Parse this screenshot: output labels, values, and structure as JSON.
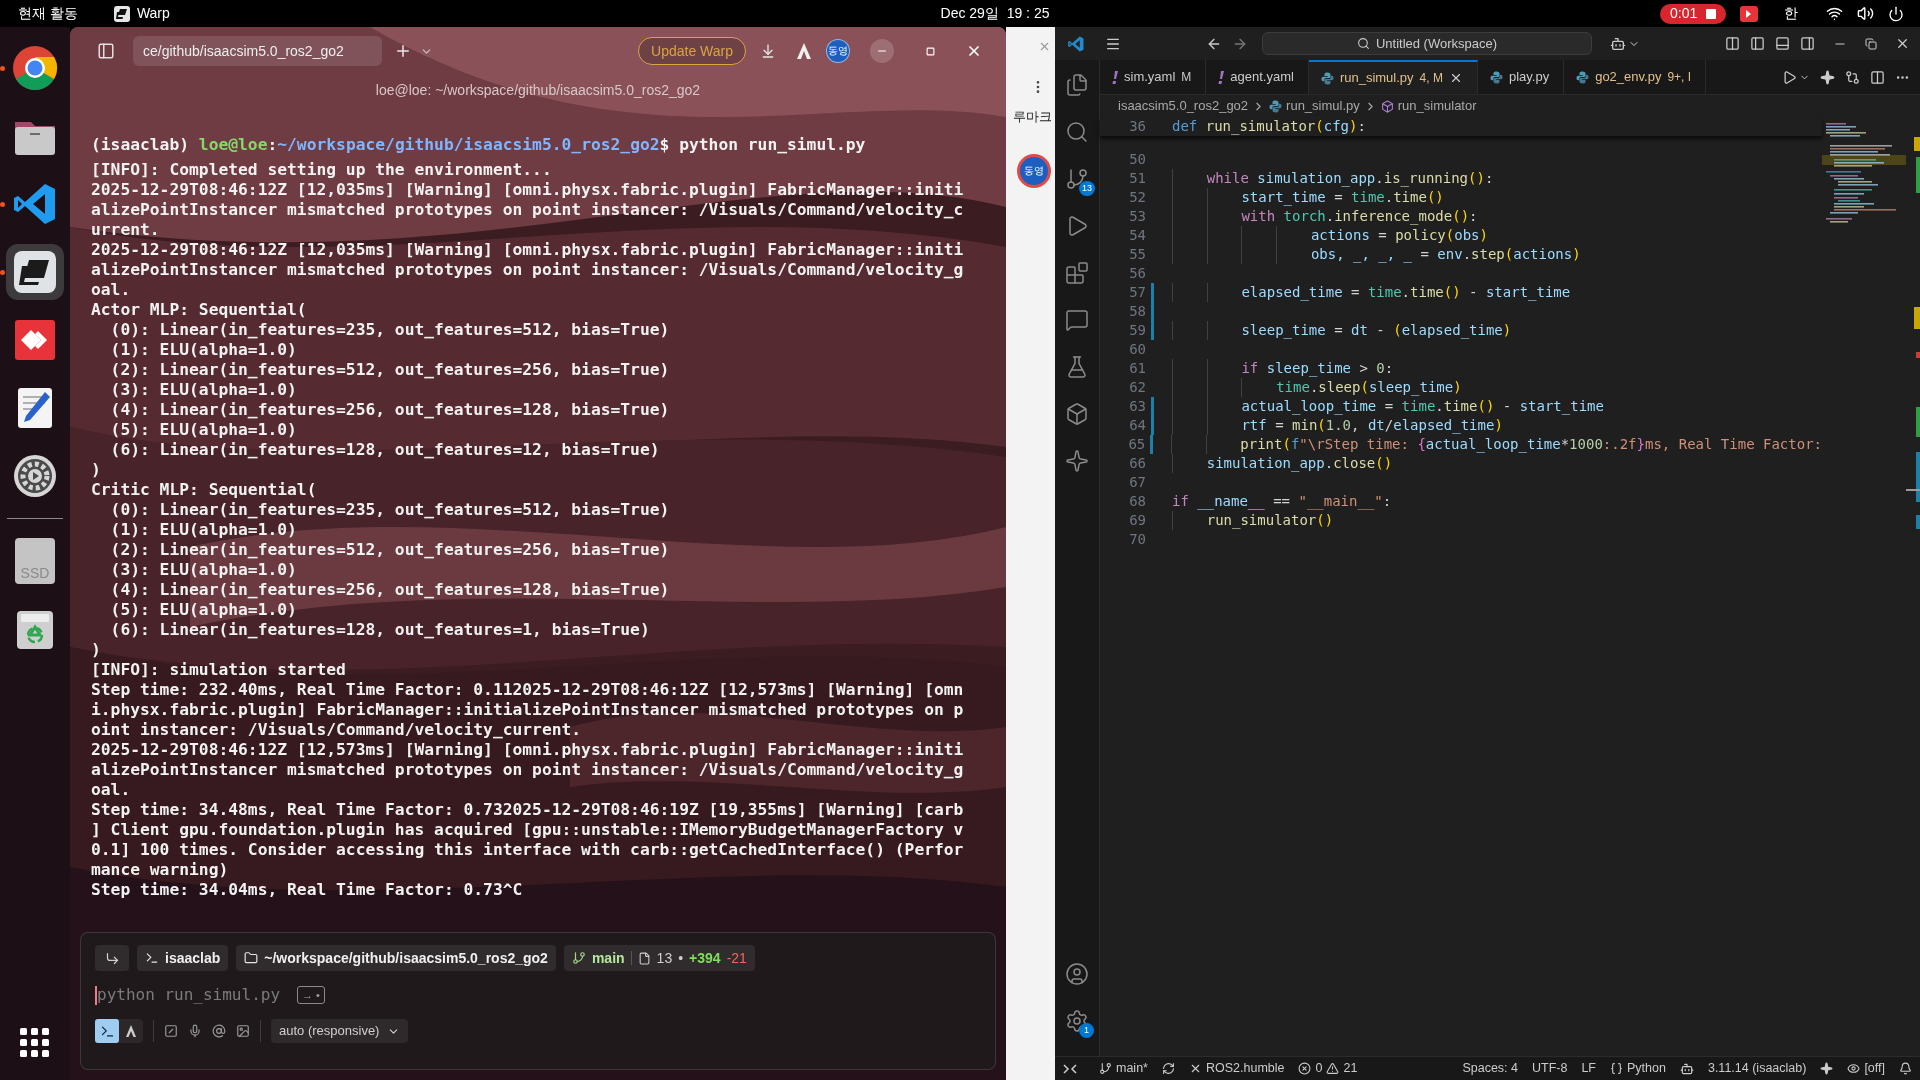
{
  "top_bar": {
    "activities": "현재 활동",
    "app_name": "Warp",
    "clock": "Dec 29일  19 : 25",
    "recording_time": "0:01",
    "input_method": "한"
  },
  "dock": {
    "items": [
      {
        "kind": "browser",
        "running": true,
        "selected": false
      },
      {
        "kind": "files",
        "running": false,
        "selected": false
      },
      {
        "kind": "code",
        "running": true,
        "selected": false
      },
      {
        "kind": "terminal",
        "running": true,
        "selected": true
      },
      {
        "kind": "remote",
        "running": false,
        "selected": false
      },
      {
        "kind": "editor",
        "running": false,
        "selected": false
      },
      {
        "kind": "settings",
        "running": false,
        "selected": false
      },
      {
        "kind": "drive",
        "running": false,
        "selected": false,
        "label": "SSD"
      },
      {
        "kind": "trash",
        "running": false,
        "selected": false
      }
    ]
  },
  "warp": {
    "tab_path": "ce/github/isaacsim5.0_ros2_go2",
    "update_button": "Update Warp",
    "avatar_badge": "동영",
    "title": "loe@loe: ~/workspace/github/isaacsim5.0_ros2_go2",
    "prompt": {
      "env": "(isaaclab) ",
      "host": "loe@loe",
      "sep": ":",
      "path": "~/workspace/github/isaacsim5.0_ros2_go2",
      "command": "$ python run_simul.py"
    },
    "output": [
      "[INFO]: Completed setting up the environment...",
      "2025-12-29T08:46:12Z [12,035ms] [Warning] [omni.physx.fabric.plugin] FabricManager::initi",
      "alizePointInstancer mismatched prototypes on point instancer: /Visuals/Command/velocity_c",
      "urrent.",
      "2025-12-29T08:46:12Z [12,035ms] [Warning] [omni.physx.fabric.plugin] FabricManager::initi",
      "alizePointInstancer mismatched prototypes on point instancer: /Visuals/Command/velocity_g",
      "oal.",
      "Actor MLP: Sequential(",
      "  (0): Linear(in_features=235, out_features=512, bias=True)",
      "  (1): ELU(alpha=1.0)",
      "  (2): Linear(in_features=512, out_features=256, bias=True)",
      "  (3): ELU(alpha=1.0)",
      "  (4): Linear(in_features=256, out_features=128, bias=True)",
      "  (5): ELU(alpha=1.0)",
      "  (6): Linear(in_features=128, out_features=12, bias=True)",
      ")",
      "Critic MLP: Sequential(",
      "  (0): Linear(in_features=235, out_features=512, bias=True)",
      "  (1): ELU(alpha=1.0)",
      "  (2): Linear(in_features=512, out_features=256, bias=True)",
      "  (3): ELU(alpha=1.0)",
      "  (4): Linear(in_features=256, out_features=128, bias=True)",
      "  (5): ELU(alpha=1.0)",
      "  (6): Linear(in_features=128, out_features=1, bias=True)",
      ")",
      "[INFO]: simulation started",
      "Step time: 232.40ms, Real Time Factor: 0.112025-12-29T08:46:12Z [12,573ms] [Warning] [omn",
      "i.physx.fabric.plugin] FabricManager::initializePointInstancer mismatched prototypes on p",
      "oint instancer: /Visuals/Command/velocity_current.",
      "2025-12-29T08:46:12Z [12,573ms] [Warning] [omni.physx.fabric.plugin] FabricManager::initi",
      "alizePointInstancer mismatched prototypes on point instancer: /Visuals/Command/velocity_g",
      "oal.",
      "Step time: 34.48ms, Real Time Factor: 0.732025-12-29T08:46:19Z [19,355ms] [Warning] [carb",
      "] Client gpu.foundation.plugin has acquired [gpu::unstable::IMemoryBudgetManagerFactory v",
      "0.1] 100 times. Consider accessing this interface with carb::getCachedInterface() (Perfor",
      "mance warning)",
      "Step time: 34.04ms, Real Time Factor: 0.73^C"
    ],
    "input": {
      "env": "isaaclab",
      "path": "~/workspace/github/isaacsim5.0_ros2_go2",
      "branch": "main",
      "files_changed": "13",
      "dot": "•",
      "additions": "+394",
      "deletions": "-21",
      "placeholder": "python run_simul.py",
      "hint": "→ •",
      "modes": [
        {
          "kind": "terminal",
          "selected": true
        },
        {
          "kind": "agent",
          "selected": false
        }
      ],
      "model": "auto (responsive)"
    }
  },
  "browser_behind": {
    "bookmark_text": "루마크",
    "badge": "동영"
  },
  "vscode": {
    "search": "Untitled (Workspace)",
    "activity": [
      {
        "kind": "files"
      },
      {
        "kind": "search"
      },
      {
        "kind": "source_control",
        "badge": "13"
      },
      {
        "kind": "run"
      },
      {
        "kind": "extensions"
      },
      {
        "kind": "chat"
      },
      {
        "kind": "testing"
      },
      {
        "kind": "containers"
      },
      {
        "kind": "sparkle"
      }
    ],
    "activity_bottom": [
      {
        "kind": "account"
      },
      {
        "kind": "settings",
        "badge": "1"
      }
    ],
    "tabs": [
      {
        "label": "sim.yaml",
        "status": "M",
        "kind": "yaml",
        "problems": false,
        "selected": false
      },
      {
        "label": "agent.yaml",
        "kind": "yaml",
        "problems": false,
        "selected": false
      },
      {
        "label": "run_simul.py",
        "status": "4, M",
        "kind": "python",
        "problems": true,
        "selected": true
      },
      {
        "label": "play.py",
        "kind": "python",
        "problems": false,
        "selected": false
      },
      {
        "label": "go2_env.py",
        "status": "9+, I",
        "kind": "python",
        "problems": true,
        "selected": false
      }
    ],
    "breadcrumb": [
      "isaacsim5.0_ros2_go2",
      "run_simul.py",
      "run_simulator"
    ],
    "sticky_line": {
      "number": "36",
      "tokens": [
        {
          "kind": "def",
          "text": "def "
        },
        {
          "kind": "fn",
          "text": "run_simulator"
        },
        {
          "kind": "p1",
          "text": "("
        },
        {
          "kind": "var",
          "text": "cfg"
        },
        {
          "kind": "p1",
          "text": ")"
        },
        {
          "kind": "txt",
          "text": ":"
        }
      ]
    },
    "lines": [
      {
        "number": "50",
        "changed": false
      },
      {
        "number": "51",
        "changed": false,
        "tokens": [
          {
            "kind": "kw",
            "text": "    while "
          },
          {
            "kind": "var",
            "text": "simulation_app"
          },
          {
            "kind": "txt",
            "text": "."
          },
          {
            "kind": "fn",
            "text": "is_running"
          },
          {
            "kind": "p1",
            "text": "()"
          },
          {
            "kind": "txt",
            "text": ":"
          }
        ]
      },
      {
        "number": "52",
        "changed": false,
        "tokens": [
          {
            "kind": "var",
            "text": "        start_time"
          },
          {
            "kind": "txt",
            "text": " = "
          },
          {
            "kind": "mod",
            "text": "time"
          },
          {
            "kind": "txt",
            "text": "."
          },
          {
            "kind": "fn",
            "text": "time"
          },
          {
            "kind": "p1",
            "text": "()"
          }
        ]
      },
      {
        "number": "53",
        "changed": false,
        "tokens": [
          {
            "kind": "kw",
            "text": "        with "
          },
          {
            "kind": "mod",
            "text": "torch"
          },
          {
            "kind": "txt",
            "text": "."
          },
          {
            "kind": "fn",
            "text": "inference_mode"
          },
          {
            "kind": "p1",
            "text": "()"
          },
          {
            "kind": "txt",
            "text": ":"
          }
        ]
      },
      {
        "number": "54",
        "changed": false,
        "tokens": [
          {
            "kind": "var",
            "text": "                actions"
          },
          {
            "kind": "txt",
            "text": " = "
          },
          {
            "kind": "fn",
            "text": "policy"
          },
          {
            "kind": "p1",
            "text": "("
          },
          {
            "kind": "var",
            "text": "obs"
          },
          {
            "kind": "p1",
            "text": ")"
          }
        ]
      },
      {
        "number": "55",
        "changed": false,
        "tokens": [
          {
            "kind": "var",
            "text": "                obs, _, _, _"
          },
          {
            "kind": "txt",
            "text": " = "
          },
          {
            "kind": "var",
            "text": "env"
          },
          {
            "kind": "txt",
            "text": "."
          },
          {
            "kind": "fn",
            "text": "step"
          },
          {
            "kind": "p1",
            "text": "("
          },
          {
            "kind": "var",
            "text": "actions"
          },
          {
            "kind": "p1",
            "text": ")"
          }
        ]
      },
      {
        "number": "56",
        "changed": false
      },
      {
        "number": "57",
        "changed": true,
        "tokens": [
          {
            "kind": "var",
            "text": "        elapsed_time"
          },
          {
            "kind": "txt",
            "text": " = "
          },
          {
            "kind": "mod",
            "text": "time"
          },
          {
            "kind": "txt",
            "text": "."
          },
          {
            "kind": "fn",
            "text": "time"
          },
          {
            "kind": "p1",
            "text": "()"
          },
          {
            "kind": "txt",
            "text": " - "
          },
          {
            "kind": "var",
            "text": "start_time"
          }
        ]
      },
      {
        "number": "58",
        "changed": true
      },
      {
        "number": "59",
        "changed": true,
        "tokens": [
          {
            "kind": "var",
            "text": "        sleep_time"
          },
          {
            "kind": "txt",
            "text": " = "
          },
          {
            "kind": "var",
            "text": "dt"
          },
          {
            "kind": "txt",
            "text": " - "
          },
          {
            "kind": "p1",
            "text": "("
          },
          {
            "kind": "var",
            "text": "elapsed_time"
          },
          {
            "kind": "p1",
            "text": ")"
          }
        ]
      },
      {
        "number": "60",
        "changed": false
      },
      {
        "number": "61",
        "changed": false,
        "tokens": [
          {
            "kind": "kw",
            "text": "        if "
          },
          {
            "kind": "var",
            "text": "sleep_time"
          },
          {
            "kind": "txt",
            "text": " > "
          },
          {
            "kind": "num",
            "text": "0"
          },
          {
            "kind": "txt",
            "text": ":"
          }
        ]
      },
      {
        "number": "62",
        "changed": false,
        "tokens": [
          {
            "kind": "mod",
            "text": "            time"
          },
          {
            "kind": "txt",
            "text": "."
          },
          {
            "kind": "fn",
            "text": "sleep"
          },
          {
            "kind": "p1",
            "text": "("
          },
          {
            "kind": "var",
            "text": "sleep_time"
          },
          {
            "kind": "p1",
            "text": ")"
          }
        ]
      },
      {
        "number": "63",
        "changed": true,
        "tokens": [
          {
            "kind": "var",
            "text": "        actual_loop_time"
          },
          {
            "kind": "txt",
            "text": " = "
          },
          {
            "kind": "mod",
            "text": "time"
          },
          {
            "kind": "txt",
            "text": "."
          },
          {
            "kind": "fn",
            "text": "time"
          },
          {
            "kind": "p1",
            "text": "()"
          },
          {
            "kind": "txt",
            "text": " - "
          },
          {
            "kind": "var",
            "text": "start_time"
          }
        ]
      },
      {
        "number": "64",
        "changed": true,
        "tokens": [
          {
            "kind": "var",
            "text": "        rtf"
          },
          {
            "kind": "txt",
            "text": " = "
          },
          {
            "kind": "fn",
            "text": "min"
          },
          {
            "kind": "p1",
            "text": "("
          },
          {
            "kind": "num",
            "text": "1.0"
          },
          {
            "kind": "txt",
            "text": ", "
          },
          {
            "kind": "var",
            "text": "dt"
          },
          {
            "kind": "txt",
            "text": "/"
          },
          {
            "kind": "var",
            "text": "elapsed_time"
          },
          {
            "kind": "p1",
            "text": ")"
          }
        ]
      },
      {
        "number": "65",
        "changed": true,
        "tokens": [
          {
            "kind": "fn",
            "text": "        print"
          },
          {
            "kind": "p1",
            "text": "("
          },
          {
            "kind": "def",
            "text": "f"
          },
          {
            "kind": "str",
            "text": "\"\\rStep time: "
          },
          {
            "kind": "p2",
            "text": "{"
          },
          {
            "kind": "var",
            "text": "actual_loop_time"
          },
          {
            "kind": "txt",
            "text": "*"
          },
          {
            "kind": "num",
            "text": "1000"
          },
          {
            "kind": "str",
            "text": ":.2f"
          },
          {
            "kind": "p2",
            "text": "}"
          },
          {
            "kind": "str",
            "text": "ms, Real Time Factor:"
          }
        ]
      },
      {
        "number": "66",
        "changed": false,
        "tokens": [
          {
            "kind": "var",
            "text": "    simulation_app."
          },
          {
            "kind": "fn",
            "text": "close"
          },
          {
            "kind": "p1",
            "text": "()"
          }
        ]
      },
      {
        "number": "67",
        "changed": false
      },
      {
        "number": "68",
        "changed": false,
        "tokens": [
          {
            "kind": "kw",
            "text": "if "
          },
          {
            "kind": "var",
            "text": "__name__"
          },
          {
            "kind": "txt",
            "text": " == "
          },
          {
            "kind": "str",
            "text": "\"__main__\""
          },
          {
            "kind": "txt",
            "text": ":"
          }
        ]
      },
      {
        "number": "69",
        "changed": false,
        "tokens": [
          {
            "kind": "fn",
            "text": "    run_simulator"
          },
          {
            "kind": "p1",
            "text": "()"
          }
        ]
      },
      {
        "number": "70",
        "changed": false
      }
    ],
    "status_bar": {
      "branch": "main*",
      "env": "ROS2.humble",
      "errors": "0",
      "warnings": "21",
      "spaces": "Spaces: 4",
      "encoding": "UTF-8",
      "eol": "LF",
      "language": "Python",
      "interpreter": "3.11.14 (isaaclab)",
      "tracking": "[off]"
    }
  }
}
